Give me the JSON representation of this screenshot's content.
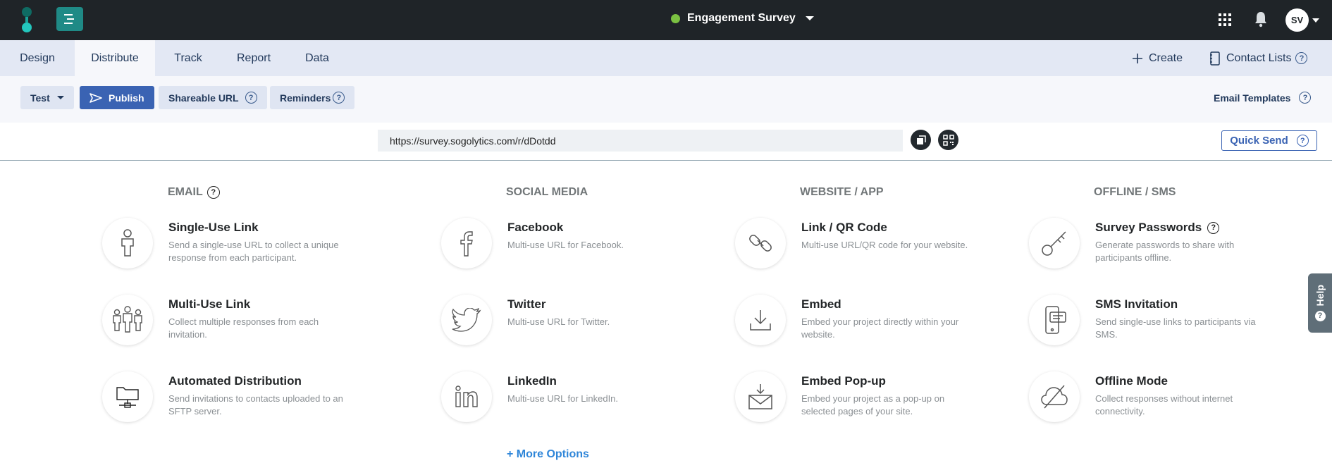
{
  "header": {
    "survey_title": "Engagement Survey",
    "status_color": "#7bc142",
    "avatar_initials": "SV",
    "icons": [
      "sogolytics-logo-icon",
      "menu-icon",
      "apps-grid-icon",
      "bell-icon",
      "chevron-down-icon"
    ]
  },
  "tabs": [
    {
      "label": "Design"
    },
    {
      "label": "Distribute"
    },
    {
      "label": "Track"
    },
    {
      "label": "Report"
    },
    {
      "label": "Data"
    }
  ],
  "tab_actions": {
    "create_label": "Create",
    "contact_lists_label": "Contact Lists"
  },
  "toolbar": {
    "test_label": "Test",
    "publish_label": "Publish",
    "shareable_url_label": "Shareable URL",
    "reminders_label": "Reminders",
    "email_templates_label": "Email Templates"
  },
  "url_bar": {
    "url_value": "https://survey.sogolytics.com/r/dDotdd",
    "quick_send_label": "Quick Send"
  },
  "columns": [
    {
      "heading": "EMAIL",
      "options": [
        {
          "title": "Single-Use Link",
          "desc": "Send a single-use URL to collect a unique response from each participant.",
          "icon": "person-link-icon"
        },
        {
          "title": "Multi-Use Link",
          "desc": "Collect multiple responses from each invitation.",
          "icon": "group-icon"
        },
        {
          "title": "Automated Distribution",
          "desc": "Send invitations to contacts uploaded to an SFTP server.",
          "icon": "folder-network-icon"
        }
      ]
    },
    {
      "heading": "SOCIAL MEDIA",
      "options": [
        {
          "title": "Facebook",
          "desc": "Multi-use URL for Facebook.",
          "icon": "facebook-icon"
        },
        {
          "title": "Twitter",
          "desc": "Multi-use URL for Twitter.",
          "icon": "twitter-icon"
        },
        {
          "title": "LinkedIn",
          "desc": "Multi-use URL for LinkedIn.",
          "icon": "linkedin-icon"
        }
      ]
    },
    {
      "heading": "WEBSITE / APP",
      "options": [
        {
          "title": "Link / QR Code",
          "desc": "Multi-use URL/QR code for your website.",
          "icon": "chain-link-icon"
        },
        {
          "title": "Embed",
          "desc": "Embed your project directly within your website.",
          "icon": "download-icon"
        },
        {
          "title": "Embed Pop-up",
          "desc": "Embed your project as a pop-up on selected pages of your site.",
          "icon": "envelope-download-icon"
        }
      ]
    },
    {
      "heading": "OFFLINE / SMS",
      "options": [
        {
          "title": "Survey Passwords",
          "desc": "Generate passwords to share with participants offline.",
          "icon": "key-icon"
        },
        {
          "title": "SMS Invitation",
          "desc": "Send single-use links to participants via SMS.",
          "icon": "phone-message-icon"
        },
        {
          "title": "Offline Mode",
          "desc": "Collect responses without internet connectivity.",
          "icon": "cloud-off-icon"
        }
      ]
    }
  ],
  "more_options_label": "+ More Options",
  "help_tab_label": "Help",
  "colors": {
    "topbar": "#1f2428",
    "tabbar": "#e3e8f4",
    "primary": "#3a63b3",
    "link": "#2f86d9"
  }
}
